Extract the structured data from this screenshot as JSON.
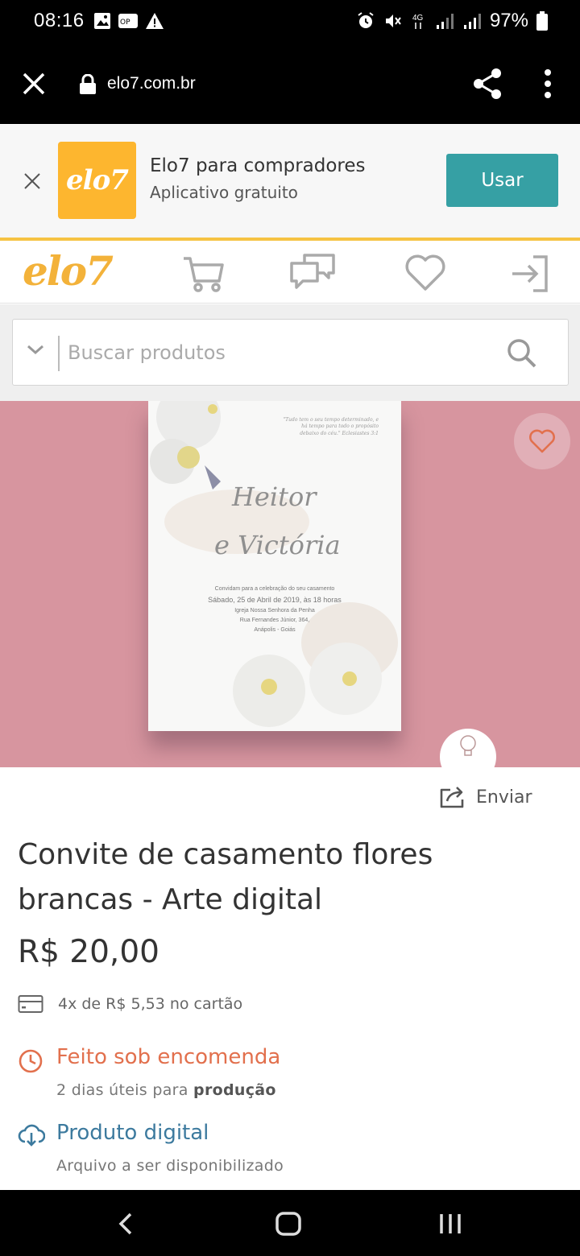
{
  "status": {
    "time": "08:16",
    "battery": "97%",
    "network": "4G"
  },
  "browser": {
    "url": "elo7.com.br"
  },
  "app_banner": {
    "logo_text": "elo7",
    "title": "Elo7 para compradores",
    "subtitle": "Aplicativo gratuito",
    "button_label": "Usar",
    "button_color": "#36a0a4"
  },
  "site": {
    "logo_text": "elo7",
    "brand_color": "#f3b23a"
  },
  "search": {
    "placeholder": "Buscar produtos"
  },
  "product_image": {
    "background": "#d7959f",
    "card": {
      "quote": "\"Tudo tem o seu tempo determinado, e há tempo para todo o propósito debaixo do céu.\" Eclesiastes 3:1",
      "name1": "Heitor",
      "name2": "e Victória",
      "line1": "Convidam para a celebração do seu casamento",
      "line2": "Sábado, 25 de Abril de 2019, às 18 horas",
      "line3": "Igreja Nossa Senhora da Penha",
      "line4": "Rua Fernandes Júnior, 364,",
      "line5": "Anápolis - Goiás"
    }
  },
  "product": {
    "send_label": "Enviar",
    "title": "Convite de casamento flores brancas - Arte digital",
    "price": "R$ 20,00",
    "installments": "4x de R$ 5,53 no cartão",
    "made_to_order": "Feito sob encomenda",
    "production_prefix": "2 dias úteis para ",
    "production_bold": "produção",
    "digital_title": "Produto digital",
    "digital_desc": "Arquivo a ser disponibilizado",
    "made_color": "#e2704d",
    "digital_color": "#3c7a9e"
  }
}
